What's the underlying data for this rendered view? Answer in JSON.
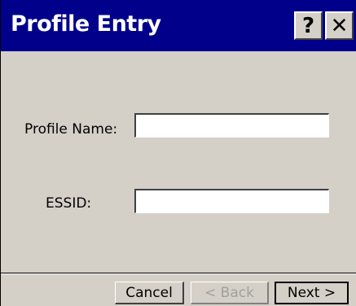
{
  "window": {
    "title": "Profile Entry",
    "help_glyph": "?",
    "close_glyph": "✕"
  },
  "form": {
    "profile_name_label": "Profile Name:",
    "profile_name_value": "",
    "essid_label": "ESSID:",
    "essid_value": ""
  },
  "buttons": {
    "cancel_label": "Cancel",
    "back_label": "< Back",
    "next_label": "Next >"
  },
  "colors": {
    "titlebar": "#00008b",
    "dialog_face": "#d4d0c8",
    "disabled_text": "#a0a0a0"
  },
  "icons": {
    "help": "help-icon",
    "close": "close-icon"
  }
}
